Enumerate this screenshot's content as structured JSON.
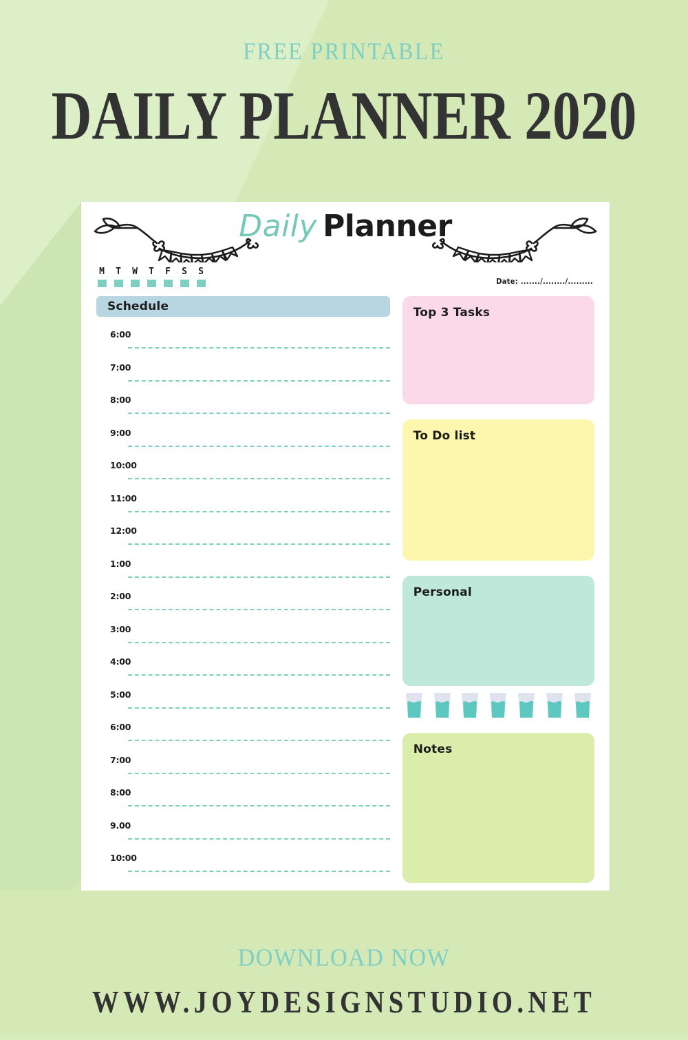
{
  "promo": {
    "eyebrow": "FREE PRINTABLE",
    "title": "DAILY PLANNER 2020",
    "cta": "DOWNLOAD NOW",
    "url": "WWW.JOYDESIGNSTUDIO.NET"
  },
  "planner": {
    "title_first": "Daily",
    "title_second": "Planner",
    "weekdays": [
      "M",
      "T",
      "W",
      "T",
      "F",
      "S",
      "S"
    ],
    "date_label": "Date:  ......./......../.........",
    "schedule": {
      "heading": "Schedule",
      "times": [
        "6:00",
        "7:00",
        "8:00",
        "9:00",
        "10:00",
        "11:00",
        "12:00",
        "1:00",
        "2:00",
        "3:00",
        "4:00",
        "5:00",
        "6:00",
        "7:00",
        "8:00",
        "9.00",
        "10:00"
      ]
    },
    "panels": {
      "top3": "Top 3 Tasks",
      "todo": "To Do list",
      "personal": "Personal",
      "notes": "Notes"
    },
    "water_tracker": {
      "count": 7
    }
  },
  "colors": {
    "page_background": "#d8ecbe",
    "accent_teal": "#7fcfc4",
    "title_dark": "#333333",
    "schedule_bar": "#b8d5e2",
    "panel_top3": "#fbd9e8",
    "panel_todo": "#fcf7ad",
    "panel_personal": "#bee8da",
    "panel_notes": "#dbedab",
    "dash_line": "#7ecfc0",
    "water": "#5cc8bf",
    "glass_top": "#dfe3ee"
  }
}
